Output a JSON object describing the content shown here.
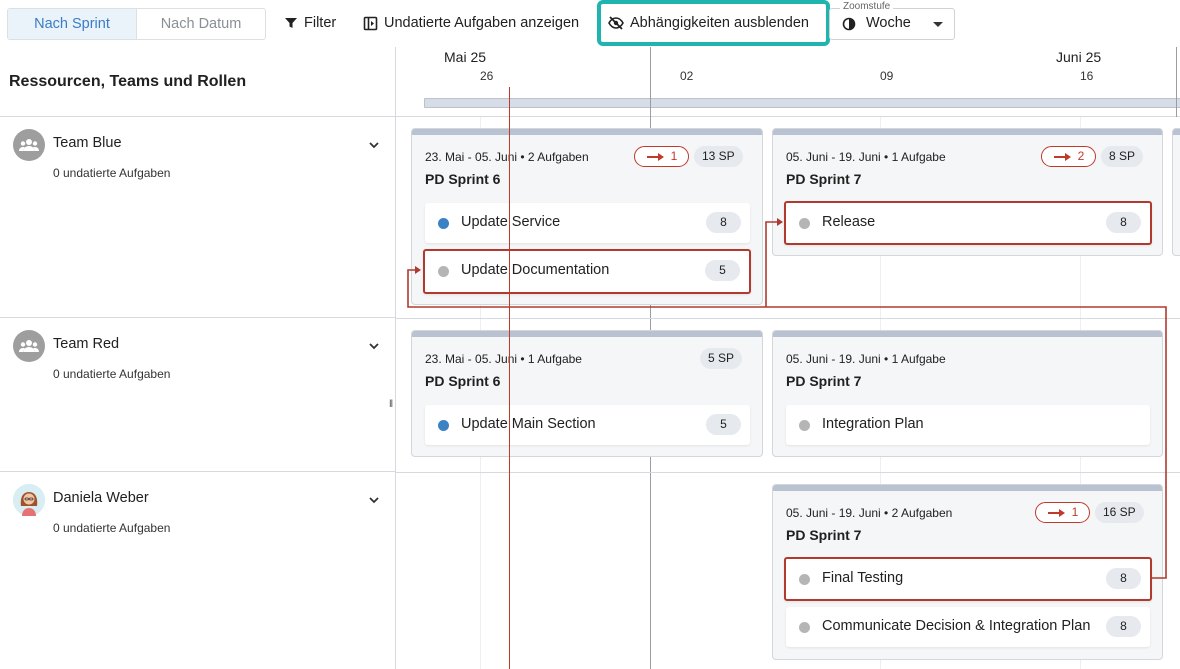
{
  "toolbar": {
    "view_by_sprint": "Nach Sprint",
    "view_by_date": "Nach Datum",
    "filter": "Filter",
    "show_undated": "Undatierte Aufgaben anzeigen",
    "hide_dependencies": "Abhängigkeiten ausblenden",
    "zoom_label": "Zoomstufe",
    "zoom_value": "Woche"
  },
  "left": {
    "title": "Ressourcen, Teams und Rollen",
    "rows": [
      {
        "name": "Team Blue",
        "sub": "0 undatierte Aufgaben",
        "avatar_icon": "team-icon"
      },
      {
        "name": "Team Red",
        "sub": "0 undatierte Aufgaben",
        "avatar_icon": "team-icon"
      },
      {
        "name": "Daniela Weber",
        "sub": "0 undatierte Aufgaben",
        "avatar_icon": "person-avatar"
      }
    ]
  },
  "timeline": {
    "months": [
      "Mai 25",
      "Juni 25"
    ],
    "weeks": [
      "26",
      "02",
      "09",
      "16"
    ]
  },
  "cards": {
    "blue_s6": {
      "meta": "23. Mai - 05. Juni • 2 Aufgaben",
      "title": "PD Sprint 6",
      "deps": "1",
      "sp": "13 SP",
      "tasks": [
        {
          "label": "Update Service",
          "pts": "8"
        },
        {
          "label": "Update Documentation",
          "pts": "5"
        }
      ]
    },
    "blue_s7": {
      "meta": "05. Juni - 19. Juni • 1 Aufgabe",
      "title": "PD Sprint 7",
      "deps": "2",
      "sp": "8 SP",
      "tasks": [
        {
          "label": "Release",
          "pts": "8"
        }
      ]
    },
    "red_s6": {
      "meta": "23. Mai - 05. Juni • 1 Aufgabe",
      "title": "PD Sprint 6",
      "sp": "5 SP",
      "tasks": [
        {
          "label": "Update Main Section",
          "pts": "5"
        }
      ]
    },
    "red_s7": {
      "meta": "05. Juni - 19. Juni • 1 Aufgabe",
      "title": "PD Sprint 7",
      "tasks": [
        {
          "label": "Integration Plan",
          "pts": ""
        }
      ]
    },
    "dw_s7": {
      "meta": "05. Juni - 19. Juni • 2 Aufgaben",
      "title": "PD Sprint 7",
      "deps": "1",
      "sp": "16 SP",
      "tasks": [
        {
          "label": "Final Testing",
          "pts": "8"
        },
        {
          "label": "Communicate Decision & Integration Plan",
          "pts": "8"
        }
      ]
    }
  },
  "colors": {
    "accent": "#3b7dc4",
    "highlight": "#1fb5ae",
    "dependency": "#c0392b",
    "status_blue": "#3b82c4",
    "status_grey": "#b5b5b5"
  }
}
